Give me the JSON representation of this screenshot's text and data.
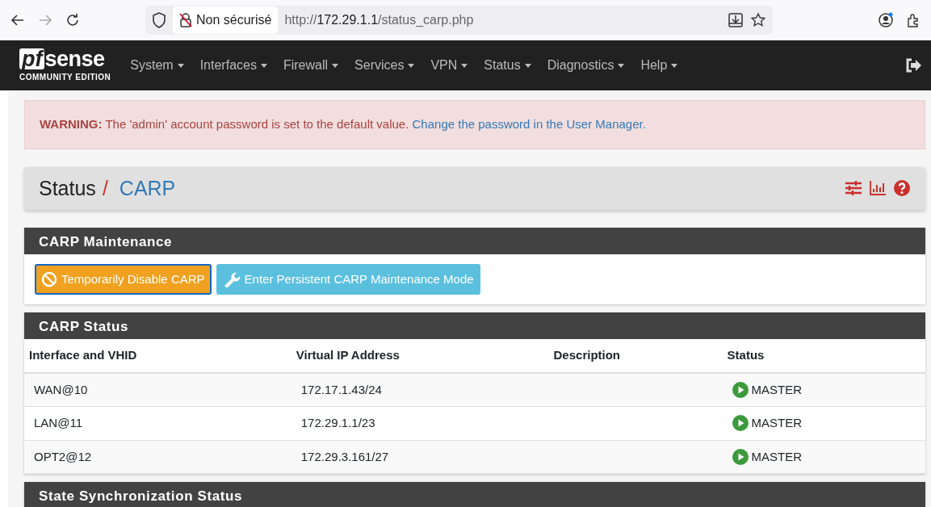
{
  "browser": {
    "security_label": "Non sécurisé",
    "url": {
      "scheme": "http://",
      "host": "172.29.1.1",
      "path": "/status_carp.php"
    },
    "forward_disabled": true
  },
  "navbar": {
    "logo": {
      "mark": "pf",
      "word": "sense",
      "tagline": "COMMUNITY EDITION"
    },
    "menu": [
      "System",
      "Interfaces",
      "Firewall",
      "Services",
      "VPN",
      "Status",
      "Diagnostics",
      "Help"
    ]
  },
  "alert": {
    "text": "**WARNING:** The 'admin' account password is set to the default value.",
    "link": "Change the password in the User Manager."
  },
  "breadcrumb": {
    "section": "Status",
    "separator": "/",
    "page": "CARP"
  },
  "panels": [
    {
      "title": "CARP Maintenance",
      "kind": "buttons",
      "buttons": [
        {
          "label": "Temporarily Disable CARP",
          "kind": "warning",
          "focused": true
        },
        {
          "label": "Enter Persistent CARP Maintenance Mode",
          "kind": "info",
          "focused": false
        }
      ]
    },
    {
      "title": "CARP Status",
      "kind": "table",
      "columns": [
        "Interface and VHID",
        "Virtual IP Address",
        "Description",
        "Status"
      ],
      "rows": [
        {
          "interface": "WAN@10",
          "vip": "172.17.1.43/24",
          "status": "MASTER"
        },
        {
          "interface": "LAN@11",
          "vip": "172.29.1.1/23",
          "status": "MASTER"
        },
        {
          "interface": "OPT2@12",
          "vip": "172.29.3.161/27",
          "status": "MASTER"
        }
      ]
    },
    {
      "title": "State Synchronization Status",
      "kind": "cut"
    }
  ]
}
